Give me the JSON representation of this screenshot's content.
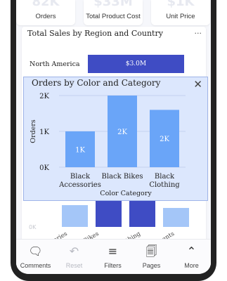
{
  "kpis": [
    {
      "value": "82K",
      "label": "Orders"
    },
    {
      "value": "$33M",
      "label": "Total Product Cost"
    },
    {
      "value": "$1K",
      "label": "Unit Price"
    }
  ],
  "card": {
    "title": "Total Sales by Region and Country",
    "more_label": "...",
    "region": {
      "label": "North America",
      "bar_value": "$3.0M"
    },
    "bg_tick": "0K",
    "bg_categories": [
      "Accessories",
      "Bikes",
      "Clothing",
      "Components"
    ]
  },
  "popup": {
    "title": "Orders by Color and Category",
    "close_glyph": "✕"
  },
  "chart_data": {
    "type": "bar",
    "title": "Orders by Color and Category",
    "xlabel": "Color Category",
    "ylabel": "Orders",
    "categories": [
      [
        "Black",
        "Accessories"
      ],
      [
        "Black Bikes"
      ],
      [
        "Black",
        "Clothing"
      ]
    ],
    "values": [
      1000,
      2000,
      1600
    ],
    "data_labels": [
      "1K",
      "2K",
      "2K"
    ],
    "ylim": [
      0,
      2000
    ],
    "yticks": [
      {
        "v": 0,
        "label": "0K"
      },
      {
        "v": 1000,
        "label": "1K"
      },
      {
        "v": 2000,
        "label": "2K"
      }
    ],
    "bar_color": "#6aa5f8",
    "grid": true
  },
  "nav": [
    {
      "label": "Comments",
      "icon": "comment-icon",
      "glyph": "🗨",
      "disabled": false
    },
    {
      "label": "Reset",
      "icon": "reset-icon",
      "glyph": "↶",
      "disabled": true
    },
    {
      "label": "Filters",
      "icon": "filter-icon",
      "glyph": "≡",
      "disabled": false
    },
    {
      "label": "Pages",
      "icon": "pages-icon",
      "glyph": "🗐",
      "disabled": false
    },
    {
      "label": "More",
      "icon": "chevron-up-icon",
      "glyph": "⌃",
      "disabled": false
    }
  ]
}
